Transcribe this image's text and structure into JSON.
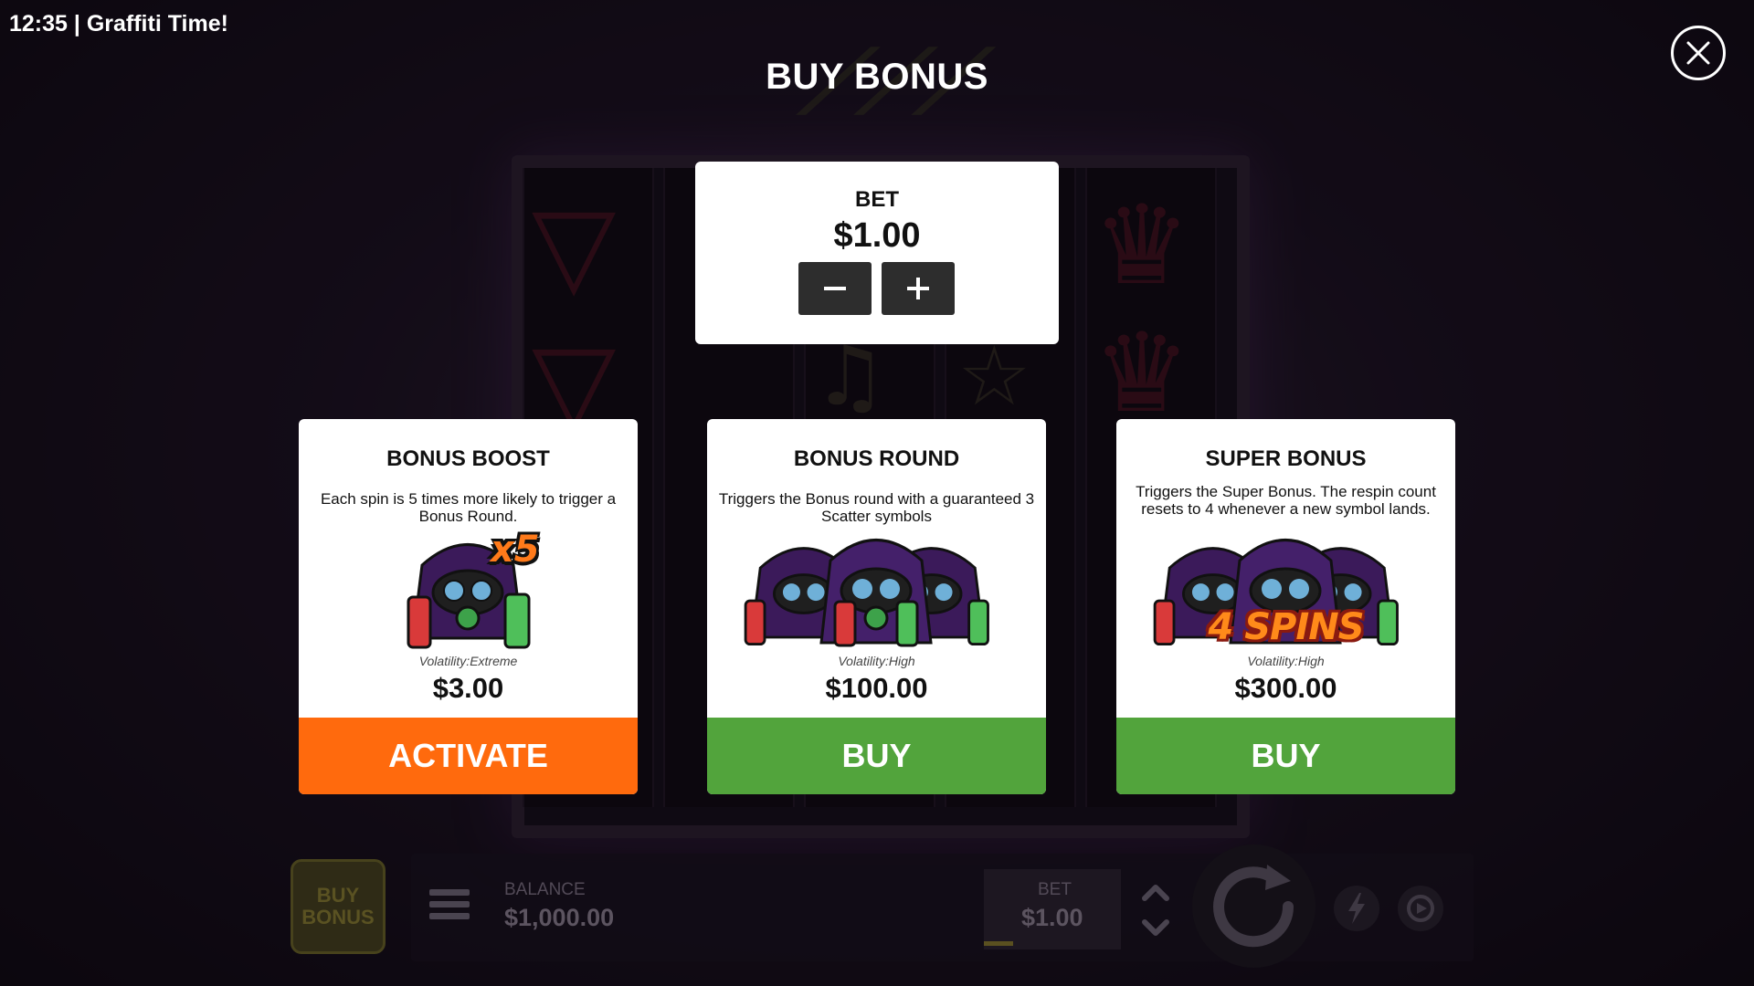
{
  "window": {
    "title": "12:35 | Graffiti Time!"
  },
  "modal": {
    "title": "BUY BONUS",
    "close_icon": "close-icon"
  },
  "bet": {
    "label": "BET",
    "value": "$1.00",
    "decrease_icon": "minus-icon",
    "increase_icon": "plus-icon"
  },
  "cards": [
    {
      "title": "BONUS BOOST",
      "description": "Each spin is 5 times more likely to trigger a Bonus Round.",
      "badge": "x5",
      "volatility": "Volatility:Extreme",
      "price": "$3.00",
      "button": "ACTIVATE",
      "button_color": "#ff6a0d"
    },
    {
      "title": "BONUS ROUND",
      "description": "Triggers the Bonus round with a guaranteed 3 Scatter symbols",
      "volatility": "Volatility:High",
      "price": "$100.00",
      "button": "BUY",
      "button_color": "#52a43c"
    },
    {
      "title": "SUPER BONUS",
      "description": "Triggers the Super Bonus. The respin count resets to 4 whenever a new symbol lands.",
      "badge": "4 SPINS",
      "volatility": "Volatility:High",
      "price": "$300.00",
      "button": "BUY",
      "button_color": "#52a43c"
    }
  ],
  "bottom_bar": {
    "buy_bonus": "BUY BONUS",
    "balance_label": "BALANCE",
    "balance_value": "$1,000.00",
    "bet_label": "BET",
    "bet_value": "$1.00",
    "icons": [
      "menu-icon",
      "bet-arrows-icon",
      "spin-icon",
      "turbo-icon",
      "autoplay-icon"
    ]
  }
}
